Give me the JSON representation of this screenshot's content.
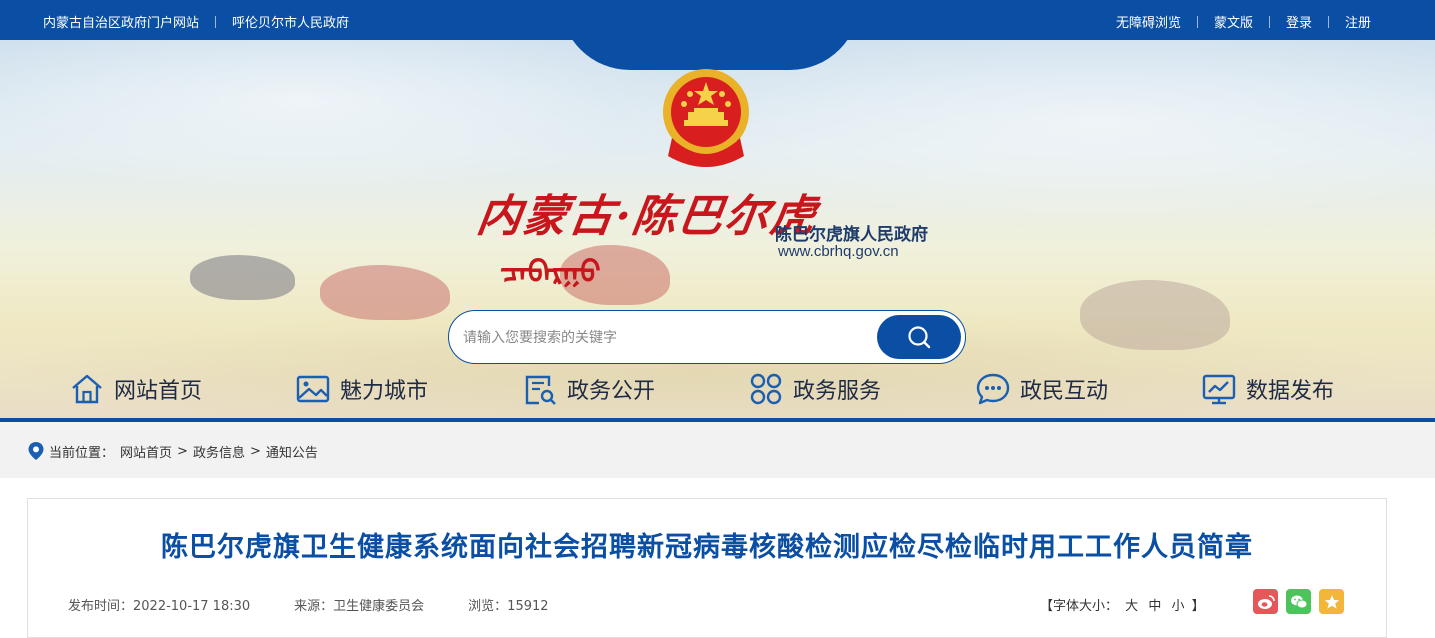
{
  "topbar": {
    "left_links": [
      "内蒙古自治区政府门户网站",
      "呼伦贝尔市人民政府"
    ],
    "right_links": [
      "无障碍浏览",
      "蒙文版",
      "登录",
      "注册"
    ]
  },
  "header": {
    "calligraphy_title": "内蒙古·陈巴尔虎",
    "mongolian_script": "ᠴᠡᠪᠠᠷᠭᠤ",
    "gov_name": "陈巴尔虎旗人民政府",
    "gov_url": "www.cbrhq.gov.cn"
  },
  "search": {
    "placeholder": "请输入您要搜索的关键字"
  },
  "nav": {
    "items": [
      {
        "label": "网站首页",
        "icon": "home-icon"
      },
      {
        "label": "魅力城市",
        "icon": "image-icon"
      },
      {
        "label": "政务公开",
        "icon": "document-search-icon"
      },
      {
        "label": "政务服务",
        "icon": "grid-services-icon"
      },
      {
        "label": "政民互动",
        "icon": "chat-icon"
      },
      {
        "label": "数据发布",
        "icon": "chart-screen-icon"
      }
    ]
  },
  "breadcrumb": {
    "prefix": "当前位置：",
    "items": [
      "网站首页",
      "政务信息",
      "通知公告"
    ],
    "separator": ">"
  },
  "article": {
    "title": "陈巴尔虎旗卫生健康系统面向社会招聘新冠病毒核酸检测应检尽检临时用工工作人员简章",
    "publish_time": "发布时间：2022-10-17 18:30",
    "source": "来源：卫生健康委员会",
    "views": "浏览：15912",
    "font_size_label_open": "【字体大小：",
    "font_size_large": "大",
    "font_size_medium": "中",
    "font_size_small": "小",
    "font_size_label_close": "】"
  },
  "colors": {
    "brand_blue": "#0b4fa5",
    "weibo": "#e6575a",
    "wechat": "#4cc45b",
    "favorite": "#f2b63b"
  }
}
